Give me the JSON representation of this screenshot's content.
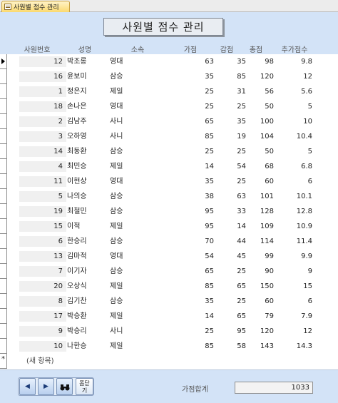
{
  "tab": {
    "label": "사원별 점수 관리",
    "icon": "form-icon"
  },
  "title": "사원별 점수 관리",
  "columns": [
    "사원번호",
    "성명",
    "소속",
    "가점",
    "감점",
    "총점",
    "추가점수"
  ],
  "rows": [
    {
      "id": "12",
      "name": "박조롱",
      "dept": "영대",
      "plus": "63",
      "minus": "35",
      "total": "98",
      "extra": "9.8"
    },
    {
      "id": "16",
      "name": "윤보미",
      "dept": "삼승",
      "plus": "35",
      "minus": "85",
      "total": "120",
      "extra": "12"
    },
    {
      "id": "1",
      "name": "정은지",
      "dept": "제일",
      "plus": "25",
      "minus": "31",
      "total": "56",
      "extra": "5.6"
    },
    {
      "id": "18",
      "name": "손나은",
      "dept": "영대",
      "plus": "25",
      "minus": "25",
      "total": "50",
      "extra": "5"
    },
    {
      "id": "2",
      "name": "김남주",
      "dept": "사니",
      "plus": "65",
      "minus": "35",
      "total": "100",
      "extra": "10"
    },
    {
      "id": "3",
      "name": "오하영",
      "dept": "사니",
      "plus": "85",
      "minus": "19",
      "total": "104",
      "extra": "10.4"
    },
    {
      "id": "14",
      "name": "최동환",
      "dept": "삼승",
      "plus": "25",
      "minus": "25",
      "total": "50",
      "extra": "5"
    },
    {
      "id": "4",
      "name": "최민승",
      "dept": "제일",
      "plus": "14",
      "minus": "54",
      "total": "68",
      "extra": "6.8"
    },
    {
      "id": "11",
      "name": "이현상",
      "dept": "영대",
      "plus": "35",
      "minus": "25",
      "total": "60",
      "extra": "6"
    },
    {
      "id": "5",
      "name": "나의승",
      "dept": "삼승",
      "plus": "38",
      "minus": "63",
      "total": "101",
      "extra": "10.1"
    },
    {
      "id": "19",
      "name": "최철민",
      "dept": "삼승",
      "plus": "95",
      "minus": "33",
      "total": "128",
      "extra": "12.8"
    },
    {
      "id": "15",
      "name": "이적",
      "dept": "제일",
      "plus": "95",
      "minus": "14",
      "total": "109",
      "extra": "10.9"
    },
    {
      "id": "6",
      "name": "한승리",
      "dept": "삼승",
      "plus": "70",
      "minus": "44",
      "total": "114",
      "extra": "11.4"
    },
    {
      "id": "13",
      "name": "김마적",
      "dept": "영대",
      "plus": "54",
      "minus": "45",
      "total": "99",
      "extra": "9.9"
    },
    {
      "id": "7",
      "name": "이기자",
      "dept": "삼승",
      "plus": "65",
      "minus": "25",
      "total": "90",
      "extra": "9"
    },
    {
      "id": "20",
      "name": "오상식",
      "dept": "제일",
      "plus": "85",
      "minus": "65",
      "total": "150",
      "extra": "15"
    },
    {
      "id": "8",
      "name": "김기찬",
      "dept": "삼승",
      "plus": "35",
      "minus": "25",
      "total": "60",
      "extra": "6"
    },
    {
      "id": "17",
      "name": "박승환",
      "dept": "제일",
      "plus": "14",
      "minus": "65",
      "total": "79",
      "extra": "7.9"
    },
    {
      "id": "9",
      "name": "박승리",
      "dept": "사니",
      "plus": "25",
      "minus": "95",
      "total": "120",
      "extra": "12"
    },
    {
      "id": "10",
      "name": "나한승",
      "dept": "제일",
      "plus": "85",
      "minus": "58",
      "total": "143",
      "extra": "14.3"
    }
  ],
  "new_row_label": "(새 항목)",
  "footer": {
    "prev_icon": "prev-record-icon",
    "next_icon": "next-record-icon",
    "find_icon": "binoculars-icon",
    "close_label_line1": "폼닫",
    "close_label_line2": "기",
    "sum_label": "가점합계",
    "sum_value": "1033"
  }
}
